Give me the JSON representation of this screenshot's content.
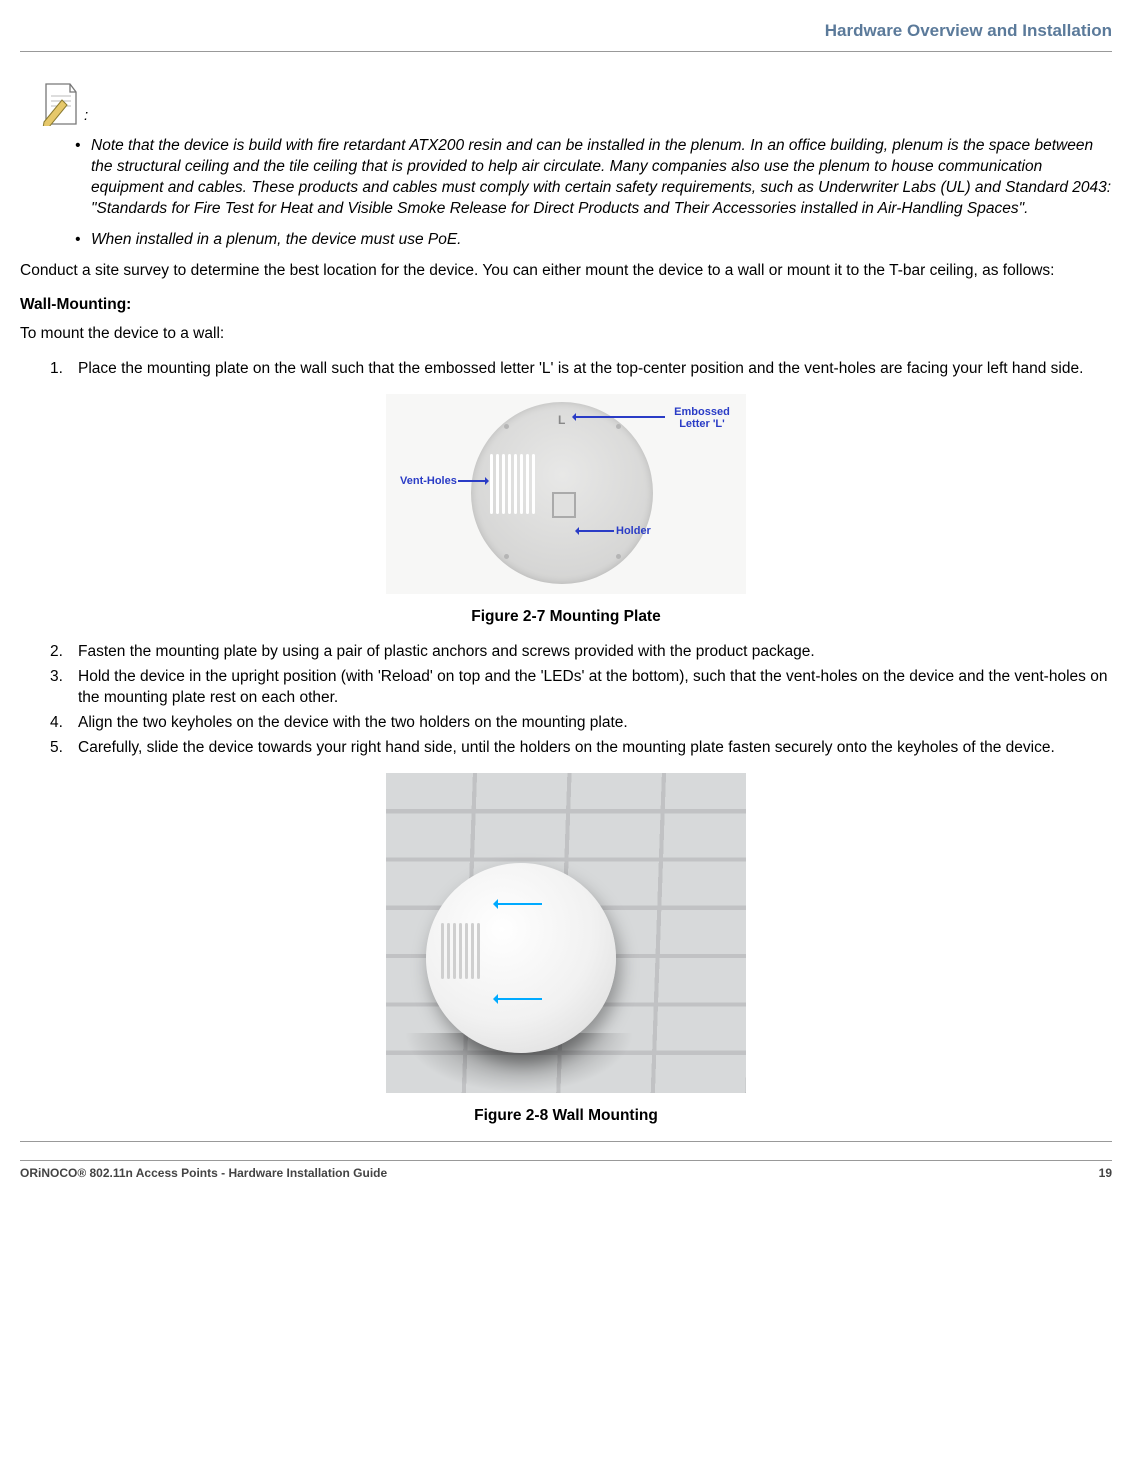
{
  "header": {
    "section_title": "Hardware Overview and Installation"
  },
  "notes": {
    "bullets": [
      "Note that the device is build with fire retardant ATX200 resin and can be installed in the plenum. In an office building, plenum is the space between the structural ceiling and the tile ceiling that is provided to help air circulate. Many companies also use the plenum to house communication equipment and cables. These products and cables must comply with certain safety requirements, such as Underwriter Labs (UL) and Standard 2043: \"Standards for Fire Test for Heat and Visible Smoke Release for Direct Products and Their Accessories installed in Air-Handling Spaces\".",
      "When installed in a plenum, the device must use PoE."
    ]
  },
  "intro_para": "Conduct a site survey to determine the best location for the device. You can either mount the device to a wall or mount it to the T-bar ceiling, as follows:",
  "wall_mounting": {
    "heading": "Wall-Mounting:",
    "lead": "To mount the device to a wall:",
    "steps_part1": [
      "Place the mounting plate on the wall such that the embossed letter 'L' is at the top-center position and the vent-holes are facing your left hand side."
    ],
    "steps_part2": [
      "Fasten the mounting plate by using a pair of plastic anchors and screws provided with the product package.",
      "Hold the device in the upright position (with 'Reload' on top and the 'LEDs' at the bottom), such that the vent-holes on the device and the vent-holes on the mounting plate rest on each other.",
      "Align the two keyholes on the device with the two holders on the mounting plate.",
      "Carefully, slide the device towards your right hand side, until the holders on the mounting plate fasten securely onto the keyholes of the device."
    ]
  },
  "figures": {
    "f27_caption": "Figure 2-7 Mounting Plate",
    "f27_labels": {
      "emboss": "Embossed Letter 'L'",
      "vent": "Vent-Holes",
      "holder": "Holder"
    },
    "f28_caption": "Figure 2-8 Wall Mounting"
  },
  "footer": {
    "doc_title": "ORiNOCO® 802.11n Access Points - Hardware Installation Guide",
    "page_number": "19"
  }
}
